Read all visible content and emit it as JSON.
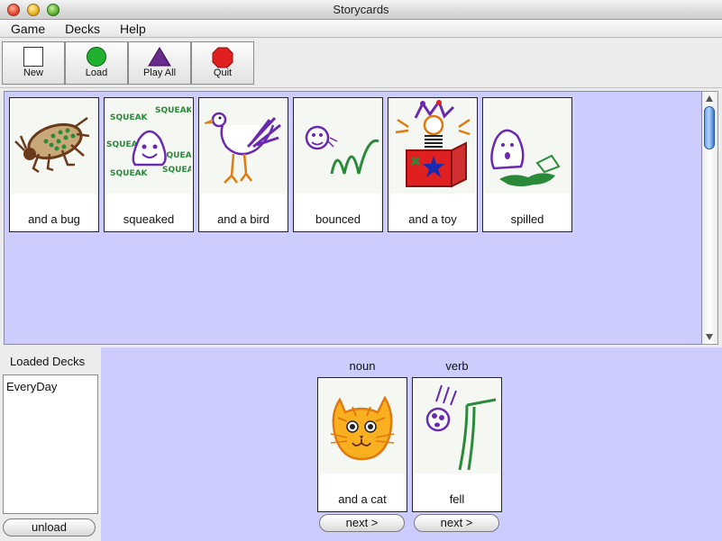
{
  "window": {
    "title": "Storycards"
  },
  "menu": [
    "Game",
    "Decks",
    "Help"
  ],
  "toolbar": {
    "new_label": "New",
    "load_label": "Load",
    "play_all_label": "Play All",
    "quit_label": "Quit"
  },
  "cards": [
    {
      "caption": "and a bug",
      "art": "bug-drawing"
    },
    {
      "caption": "squeaked",
      "art": "squeak-drawing",
      "art_text": "SQUEAK"
    },
    {
      "caption": "and a bird",
      "art": "bird-drawing"
    },
    {
      "caption": "bounced",
      "art": "bounce-drawing"
    },
    {
      "caption": "and a toy",
      "art": "jack-in-the-box-drawing"
    },
    {
      "caption": "spilled",
      "art": "spill-drawing"
    }
  ],
  "decks": {
    "label": "Loaded Decks",
    "items": [
      "EveryDay"
    ],
    "unload_label": "unload"
  },
  "slots": [
    {
      "label": "noun",
      "caption": "and a cat",
      "next_label": "next >",
      "art": "cat-drawing"
    },
    {
      "label": "verb",
      "caption": "fell",
      "next_label": "next >",
      "art": "fall-drawing"
    }
  ],
  "colors": {
    "card_area_bg": "#ccccff",
    "load_green": "#22b030",
    "play_purple": "#6a2a8a",
    "quit_red": "#e02020"
  }
}
